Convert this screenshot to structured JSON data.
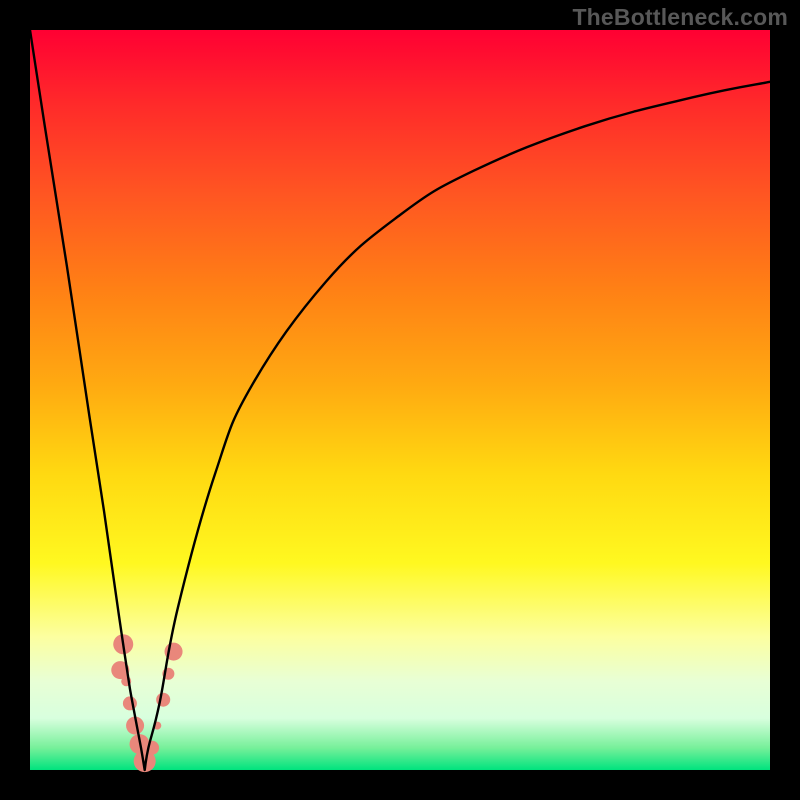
{
  "attribution": "TheBottleneck.com",
  "colors": {
    "frame": "#000000",
    "curve": "#000000",
    "marker": "#e9877b"
  },
  "chart_data": {
    "type": "line",
    "title": "",
    "xlabel": "",
    "ylabel": "",
    "xlim": [
      0,
      100
    ],
    "ylim": [
      0,
      100
    ],
    "grid": false,
    "legend": false,
    "notch_x": 15.5,
    "series": [
      {
        "name": "absolute-deviation-curve",
        "description": "V-shaped bottleneck curve, minimum at x≈15.5, right arm rising to ~93% at x=100",
        "x": [
          0,
          2,
          5,
          8,
          10,
          12,
          13.5,
          15,
          15.5,
          16,
          17.5,
          20,
          25,
          30,
          40,
          50,
          60,
          75,
          90,
          100
        ],
        "y": [
          100,
          87,
          68,
          48,
          35,
          21,
          11,
          3,
          0,
          3,
          9,
          22,
          40,
          52,
          66,
          75,
          81,
          87,
          91,
          93
        ]
      }
    ],
    "markers": [
      {
        "x": 12.6,
        "y": 17,
        "r": 10
      },
      {
        "x": 12.2,
        "y": 13.5,
        "r": 9
      },
      {
        "x": 13.0,
        "y": 12,
        "r": 5
      },
      {
        "x": 13.5,
        "y": 9,
        "r": 7
      },
      {
        "x": 14.2,
        "y": 6,
        "r": 9
      },
      {
        "x": 14.8,
        "y": 3.5,
        "r": 10
      },
      {
        "x": 15.5,
        "y": 1.2,
        "r": 11
      },
      {
        "x": 16.5,
        "y": 3,
        "r": 7
      },
      {
        "x": 17.2,
        "y": 6,
        "r": 4
      },
      {
        "x": 18.0,
        "y": 9.5,
        "r": 7
      },
      {
        "x": 18.7,
        "y": 13,
        "r": 6
      },
      {
        "x": 19.4,
        "y": 16,
        "r": 9
      }
    ]
  }
}
